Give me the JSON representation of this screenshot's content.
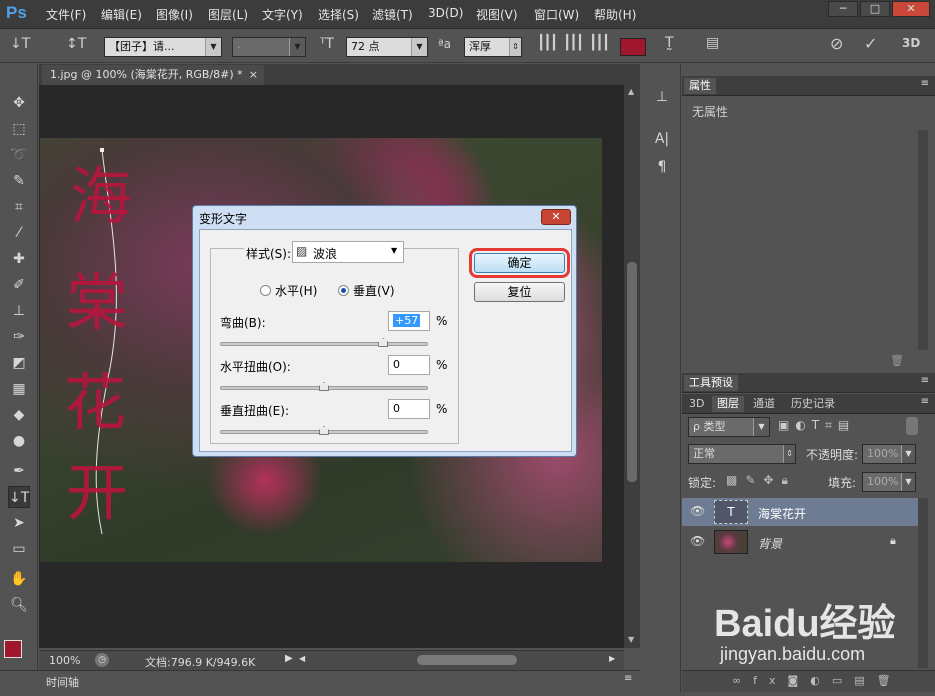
{
  "app": {
    "logo": "Ps"
  },
  "menu": [
    "文件(F)",
    "编辑(E)",
    "图像(I)",
    "图层(L)",
    "文字(Y)",
    "选择(S)",
    "滤镜(T)",
    "3D(D)",
    "视图(V)",
    "窗口(W)",
    "帮助(H)"
  ],
  "window_controls": {
    "minimize": "─",
    "maximize": "□",
    "close": "✕"
  },
  "options": {
    "font_family": "【团子】请...",
    "font_style": "-",
    "font_size": "72 点",
    "aa_label": "ªa",
    "antialias": "浑厚",
    "text_color": "#a0162d",
    "threed": "3D"
  },
  "document": {
    "tab_title": "1.jpg @ 100% (海棠花开, RGB/8#) *",
    "tab_close": "×",
    "canvas_text": [
      "海",
      "棠",
      "花",
      "开"
    ],
    "zoom": "100%",
    "doc_size": "文档:796.9 K/949.6K"
  },
  "timeline": {
    "label": "时间轴"
  },
  "properties_panel": {
    "title": "属性",
    "content": "无属性"
  },
  "tool_presets_panel": {
    "title": "工具预设"
  },
  "layers_panel": {
    "tabs": [
      "3D",
      "图层",
      "通道",
      "历史记录"
    ],
    "active_tab": "图层",
    "filter_kind": "ρ 类型",
    "blend_mode": "正常",
    "opacity_label": "不透明度:",
    "opacity_value": "100%",
    "lock_label": "锁定:",
    "fill_label": "填充:",
    "fill_value": "100%",
    "layers": [
      {
        "name": "海棠花开",
        "type": "text",
        "thumb_glyph": "T"
      },
      {
        "name": "背景",
        "type": "image"
      }
    ]
  },
  "dialog": {
    "title": "变形文字",
    "close": "✕",
    "style_label": "样式(S):",
    "style_icon": "▨",
    "style_value": "波浪",
    "orientation_horizontal": "水平(H)",
    "orientation_vertical": "垂直(V)",
    "selected_orientation": "vertical",
    "bend_label": "弯曲(B):",
    "bend_value": "+57",
    "h_distort_label": "水平扭曲(O):",
    "h_distort_value": "0",
    "v_distort_label": "垂直扭曲(E):",
    "v_distort_value": "0",
    "percent": "%",
    "ok_button": "确定",
    "reset_button": "复位"
  },
  "watermark": {
    "brand": "Baidu经验",
    "url": "jingyan.baidu.com"
  }
}
